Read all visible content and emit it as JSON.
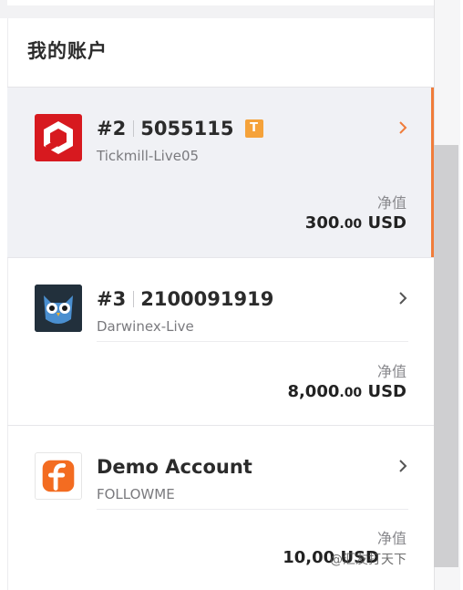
{
  "panel": {
    "title": "我的账户"
  },
  "accounts": [
    {
      "number": "#2",
      "login": "5055115",
      "badge": "T",
      "server": "Tickmill-Live05",
      "equity_label": "净值",
      "equity_int": "300",
      "equity_dec": ".00",
      "currency": "USD",
      "logo_icon": "tickmill-logo",
      "active": true
    },
    {
      "number": "#3",
      "login": "2100091919",
      "server": "Darwinex-Live",
      "equity_label": "净值",
      "equity_int": "8,000",
      "equity_dec": ".00",
      "currency": "USD",
      "logo_icon": "darwinex-owl-logo",
      "active": false
    },
    {
      "name": "Demo Account",
      "server": "FOLLOWME",
      "equity_label": "净值",
      "equity_int": "10,00",
      "currency": "USD",
      "logo_icon": "followme-logo",
      "active": false
    }
  ],
  "colors": {
    "accent": "#f07c3a",
    "badge": "#f5a23a",
    "tickmill_red": "#d7191f",
    "followme_orange": "#f36c21"
  },
  "watermark": "@汇友打天下"
}
